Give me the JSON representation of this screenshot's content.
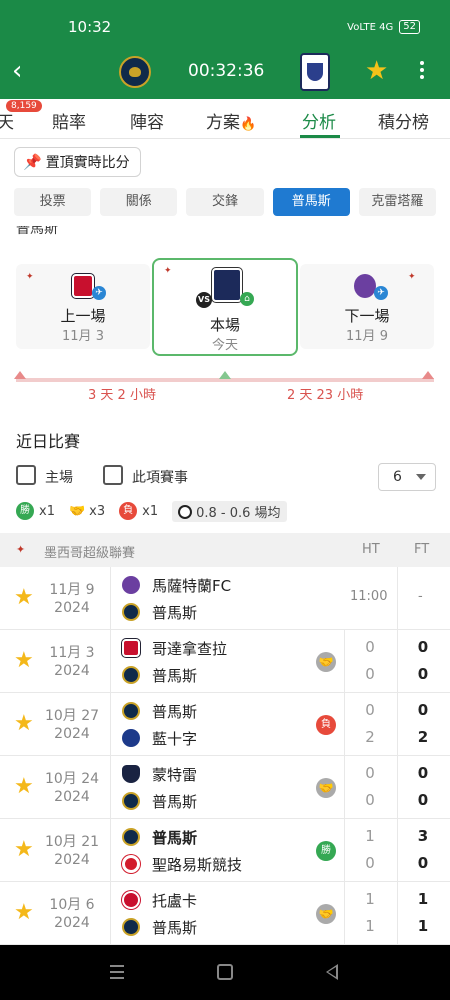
{
  "status": {
    "time": "10:32",
    "net": "VoLTE 4G",
    "battery": "52"
  },
  "header": {
    "clock": "00:32:36"
  },
  "tabs": [
    {
      "label": "天"
    },
    {
      "label": "賠率"
    },
    {
      "label": "陣容"
    },
    {
      "label": "方案"
    },
    {
      "label": "分析"
    },
    {
      "label": "積分榜"
    }
  ],
  "badge_count": "8,159",
  "pin_label": "置頂實時比分",
  "segments": [
    "投票",
    "關係",
    "交鋒",
    "普馬斯",
    "克雷塔羅"
  ],
  "partial_title": "普馬斯",
  "cards": {
    "prev": {
      "title": "上一場",
      "date": "11月 3"
    },
    "now": {
      "title": "本場",
      "date": "今天"
    },
    "next": {
      "title": "下一場",
      "date": "11月 9"
    }
  },
  "timeline": {
    "left": "3 天 2 小時",
    "right": "2 天 23 小時"
  },
  "recent": {
    "title": "近日比賽",
    "filter_home": "主場",
    "filter_comp": "此項賽事",
    "count_value": "6",
    "win_label": "勝",
    "win_count": "x1",
    "draw_count": "x3",
    "loss_label": "負",
    "loss_count": "x1",
    "avg": "0.8 - 0.6 場均"
  },
  "league": {
    "name": "墨西哥超級聯賽",
    "ht": "HT",
    "ft": "FT"
  },
  "matches": [
    {
      "date1": "11月 9",
      "date2": "2024",
      "home": "馬薩特蘭FC",
      "away": "普馬斯",
      "time": "11:00",
      "dash": "-"
    },
    {
      "date1": "11月 3",
      "date2": "2024",
      "home": "哥達拿查拉",
      "away": "普馬斯",
      "ht1": "0",
      "ht2": "0",
      "ft1": "0",
      "ft2": "0",
      "res": "draw"
    },
    {
      "date1": "10月 27",
      "date2": "2024",
      "home": "普馬斯",
      "away": "藍十字",
      "ht1": "0",
      "ht2": "2",
      "ft1": "0",
      "ft2": "2",
      "res": "loss",
      "res_label": "負"
    },
    {
      "date1": "10月 24",
      "date2": "2024",
      "home": "蒙特雷",
      "away": "普馬斯",
      "ht1": "0",
      "ht2": "0",
      "ft1": "0",
      "ft2": "0",
      "res": "draw"
    },
    {
      "date1": "10月 21",
      "date2": "2024",
      "home": "普馬斯",
      "away": "聖路易斯競技",
      "ht1": "1",
      "ht2": "0",
      "ft1": "3",
      "ft2": "0",
      "res": "win",
      "res_label": "勝"
    },
    {
      "date1": "10月 6",
      "date2": "2024",
      "home": "托盧卡",
      "away": "普馬斯",
      "ht1": "1",
      "ht2": "1",
      "ft1": "1",
      "ft2": "1",
      "res": "draw"
    }
  ],
  "colors": {
    "brand": "#1b8a47",
    "active_seg": "#1f7ad1",
    "win": "#35a853",
    "loss": "#e74a3b",
    "star": "#f4b81a"
  }
}
